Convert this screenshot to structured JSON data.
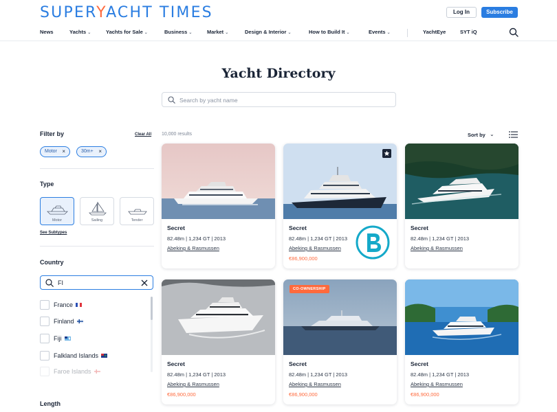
{
  "header": {
    "logo_left": "SUPER",
    "logo_accent": "Y",
    "logo_right": "ACHT TIMES",
    "login_label": "Log In",
    "subscribe_label": "Subscribe",
    "nav": [
      {
        "label": "News",
        "dropdown": false
      },
      {
        "label": "Yachts",
        "dropdown": true
      },
      {
        "label": "Yachts for Sale",
        "dropdown": true
      },
      {
        "label": "Business",
        "dropdown": true
      },
      {
        "label": "Market",
        "dropdown": true
      },
      {
        "label": "Design & Interior",
        "dropdown": true
      },
      {
        "label": "How to Build It",
        "dropdown": true
      },
      {
        "label": "Events",
        "dropdown": true
      },
      {
        "label": "YachtEye",
        "dropdown": false
      },
      {
        "label": "SYT iQ",
        "dropdown": false
      }
    ]
  },
  "page": {
    "title": "Yacht Directory",
    "search_placeholder": "Search by yacht name"
  },
  "sidebar": {
    "filter_by": "Filter by",
    "clear_all": "Clear All",
    "chips": [
      "Motor",
      "30m+"
    ],
    "type_title": "Type",
    "types": [
      {
        "label": "Motor",
        "selected": true
      },
      {
        "label": "Sailing",
        "selected": false
      },
      {
        "label": "Tender",
        "selected": false
      }
    ],
    "see_subtypes": "See Subtypes",
    "country_title": "Country",
    "country_query": "FI",
    "countries": [
      {
        "name": "France",
        "flag": "france"
      },
      {
        "name": "Finland",
        "flag": "finland"
      },
      {
        "name": "Fiji",
        "flag": "fiji"
      },
      {
        "name": "Falkland Islands",
        "flag": "falkland"
      },
      {
        "name": "Faroe Islands",
        "flag": "faroe"
      }
    ],
    "length_title": "Length"
  },
  "results": {
    "count": "10,000 results",
    "sort_label": "Sort by"
  },
  "cards": [
    {
      "name": "Secret",
      "specs": "82.48m | 1,234 GT | 2013",
      "builder": "Abeking & Rasmussen",
      "price": "",
      "badge": "",
      "starred": false,
      "brand_logo": false
    },
    {
      "name": "Secret",
      "specs": "82.48m | 1,234 GT | 2013",
      "builder": "Abeking & Rasmussen",
      "price": "€86,900,000",
      "badge": "",
      "starred": true,
      "brand_logo": true
    },
    {
      "name": "Secret",
      "specs": "82.48m | 1,234 GT | 2013",
      "builder": "Abeking & Rasmussen",
      "price": "",
      "badge": "",
      "starred": false,
      "brand_logo": false
    },
    {
      "name": "Secret",
      "specs": "82.48m | 1,234 GT | 2013",
      "builder": "Abeking & Rasmussen",
      "price": "€86,900,000",
      "badge": "",
      "starred": false,
      "brand_logo": false
    },
    {
      "name": "Secret",
      "specs": "82.48m | 1,234 GT | 2013",
      "builder": "Abeking & Rasmussen",
      "price": "€86,900,000",
      "badge": "CO-OWNERSHIP",
      "starred": false,
      "brand_logo": false
    },
    {
      "name": "Secret",
      "specs": "82.48m | 1,234 GT | 2013",
      "builder": "Abeking & Rasmussen",
      "price": "€86,900,000",
      "badge": "",
      "starred": false,
      "brand_logo": false
    }
  ],
  "colors": {
    "brand_blue": "#2a7de1",
    "accent_orange": "#ff6a3d",
    "text_dark": "#1a2436"
  }
}
